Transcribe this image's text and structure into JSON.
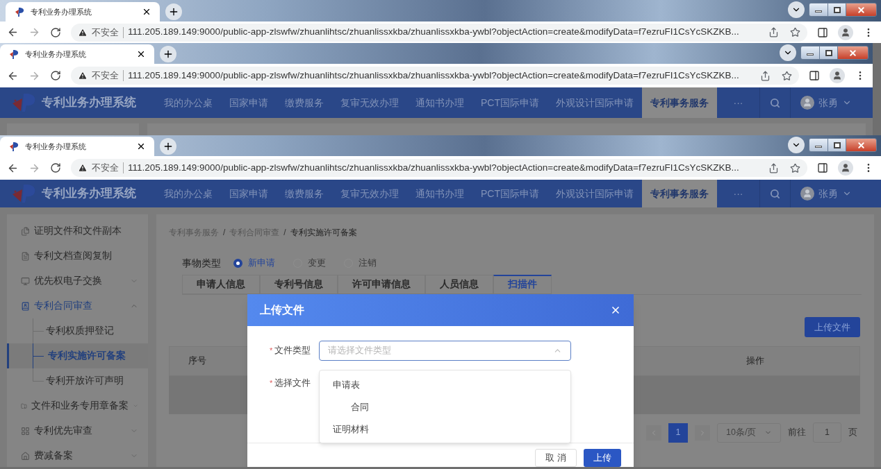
{
  "screens": [
    {
      "browser": {
        "tab_title": "专利业务办理系统",
        "security": "不安全",
        "url": "111.205.189.149:9000/public-app-zlswfw/zhuanlihtsc/zhuanlissxkba/zhuanlissxkba-ywbl?objectAction=create&modifyData=f7ezruFI1CsYcSKZKB..."
      }
    },
    {
      "browser": {
        "tab_title": "专利业务办理系统",
        "security": "不安全",
        "url": "111.205.189.149:9000/public-app-zlswfw/zhuanlihtsc/zhuanlissxkba/zhuanlissxkba-ywbl?objectAction=create&modifyData=f7ezruFI1CsYcSKZKB..."
      },
      "header": {
        "app_name": "专利业务办理系统",
        "nav": [
          {
            "label": "我的办公桌",
            "selected": false
          },
          {
            "label": "国家申请",
            "selected": false
          },
          {
            "label": "缴费服务",
            "selected": false
          },
          {
            "label": "复审无效办理",
            "selected": false
          },
          {
            "label": "通知书办理",
            "selected": false
          },
          {
            "label": "PCT国际申请",
            "selected": false
          },
          {
            "label": "外观设计国际申请",
            "selected": false
          },
          {
            "label": "专利事务服务",
            "selected": true
          }
        ],
        "more": "···",
        "user": "张勇"
      }
    },
    {
      "browser": {
        "tab_title": "专利业务办理系统",
        "security": "不安全",
        "url": "111.205.189.149:9000/public-app-zlswfw/zhuanlihtsc/zhuanlissxkba/zhuanlissxkba-ywbl?objectAction=create&modifyData=f7ezruFI1CsYcSKZKB..."
      },
      "header": {
        "app_name": "专利业务办理系统",
        "nav": [
          {
            "label": "我的办公桌",
            "selected": false
          },
          {
            "label": "国家申请",
            "selected": false
          },
          {
            "label": "缴费服务",
            "selected": false
          },
          {
            "label": "复审无效办理",
            "selected": false
          },
          {
            "label": "通知书办理",
            "selected": false
          },
          {
            "label": "PCT国际申请",
            "selected": false
          },
          {
            "label": "外观设计国际申请",
            "selected": false
          },
          {
            "label": "专利事务服务",
            "selected": true
          }
        ],
        "more": "···",
        "user": "张勇"
      },
      "sidebar": {
        "items": [
          {
            "label": "证明文件和文件副本",
            "kind": "link",
            "selected": false
          },
          {
            "label": "专利文档查阅复制",
            "kind": "link",
            "selected": false
          },
          {
            "label": "优先权电子交换",
            "kind": "group",
            "selected": false,
            "expanded": false
          },
          {
            "label": "专利合同审查",
            "kind": "group",
            "selected": true,
            "expanded": true,
            "children": [
              {
                "label": "专利权质押登记",
                "selected": false
              },
              {
                "label": "专利实施许可备案",
                "selected": true
              },
              {
                "label": "专利开放许可声明",
                "selected": false
              }
            ]
          },
          {
            "label": "文件和业务专用章备案",
            "kind": "group",
            "selected": false,
            "expanded": false
          },
          {
            "label": "专利优先审查",
            "kind": "group",
            "selected": false,
            "expanded": false
          },
          {
            "label": "费减备案",
            "kind": "group",
            "selected": false,
            "expanded": false
          }
        ]
      },
      "breadcrumb": [
        "专利事务服务",
        "专利合同审查",
        "专利实施许可备案"
      ],
      "breadcrumb_separator": "/",
      "transaction_type": {
        "label": "事物类型",
        "options": [
          {
            "label": "新申请",
            "selected": true
          },
          {
            "label": "变更",
            "selected": false
          },
          {
            "label": "注销",
            "selected": false
          }
        ]
      },
      "tabs": [
        {
          "label": "申请人信息",
          "selected": false
        },
        {
          "label": "专利号信息",
          "selected": false
        },
        {
          "label": "许可申请信息",
          "selected": false
        },
        {
          "label": "人员信息",
          "selected": false
        },
        {
          "label": "扫描件",
          "selected": true
        }
      ],
      "upload_button": "上传文件",
      "table": {
        "columns": [
          "序号",
          "操作"
        ]
      },
      "pagination": {
        "pages": [
          {
            "label": "1",
            "selected": true
          }
        ],
        "page_size": "10条/页",
        "goto_label": "前往",
        "goto_value": "1",
        "goto_unit": "页"
      },
      "modal": {
        "title": "上传文件",
        "fields": [
          {
            "label": "文件类型",
            "required_mark": "*",
            "kind": "select",
            "placeholder": "请选择文件类型",
            "expanded": true
          },
          {
            "label": "选择文件",
            "required_mark": "*",
            "kind": "file"
          }
        ],
        "options": [
          {
            "label": "申请表",
            "children": [
              {
                "label": "合同"
              }
            ]
          },
          {
            "label": "证明材料"
          }
        ],
        "buttons": [
          {
            "label": "取 消",
            "kind": "secondary"
          },
          {
            "label": "上传",
            "kind": "primary"
          }
        ]
      }
    }
  ]
}
